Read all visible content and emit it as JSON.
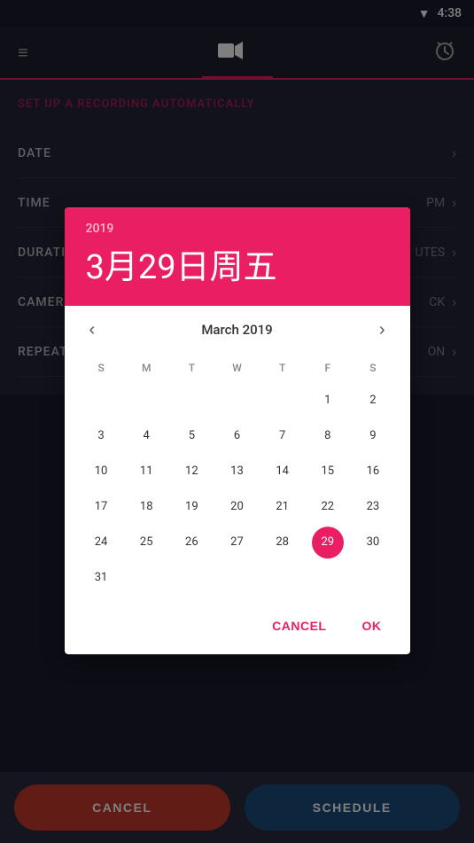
{
  "statusBar": {
    "time": "4:38",
    "wifiIcon": "▼"
  },
  "navBar": {
    "menuIcon": "≡",
    "videoIcon": "▶",
    "alarmIcon": "⏰"
  },
  "page": {
    "title": "SET UP A RECORDING AUTOMATICALLY",
    "rows": [
      {
        "label": "DATE",
        "value": ""
      },
      {
        "label": "TIME",
        "value": "PM"
      },
      {
        "label": "DURATION",
        "value": "UTES"
      },
      {
        "label": "CAMERA",
        "value": "CK"
      },
      {
        "label": "REPEAT",
        "value": "ON"
      }
    ]
  },
  "dialog": {
    "year": "2019",
    "dateDisplay": "3月29日周五",
    "monthLabel": "March 2019",
    "prevIcon": "‹",
    "nextIcon": "›",
    "weekdays": [
      "S",
      "M",
      "T",
      "W",
      "T",
      "F",
      "S"
    ],
    "selectedDay": 29,
    "cancelLabel": "CANCEL",
    "okLabel": "OK",
    "days": [
      {
        "day": "",
        "col": 1
      },
      {
        "day": "",
        "col": 2
      },
      {
        "day": "",
        "col": 3
      },
      {
        "day": "",
        "col": 4
      },
      {
        "day": "",
        "col": 5
      },
      {
        "day": 1,
        "col": 6
      },
      {
        "day": 2,
        "col": 7
      },
      {
        "day": 3
      },
      {
        "day": 4
      },
      {
        "day": 5
      },
      {
        "day": 6
      },
      {
        "day": 7
      },
      {
        "day": 8
      },
      {
        "day": 9
      },
      {
        "day": 10
      },
      {
        "day": 11
      },
      {
        "day": 12
      },
      {
        "day": 13
      },
      {
        "day": 14
      },
      {
        "day": 15
      },
      {
        "day": 16
      },
      {
        "day": 17
      },
      {
        "day": 18
      },
      {
        "day": 19
      },
      {
        "day": 20
      },
      {
        "day": 21
      },
      {
        "day": 22
      },
      {
        "day": 23
      },
      {
        "day": 24
      },
      {
        "day": 25
      },
      {
        "day": 26
      },
      {
        "day": 27
      },
      {
        "day": 28
      },
      {
        "day": 29
      },
      {
        "day": 30
      },
      {
        "day": 31
      }
    ]
  },
  "bottomBar": {
    "cancelLabel": "CANCEL",
    "scheduleLabel": "SCHEDULE"
  }
}
